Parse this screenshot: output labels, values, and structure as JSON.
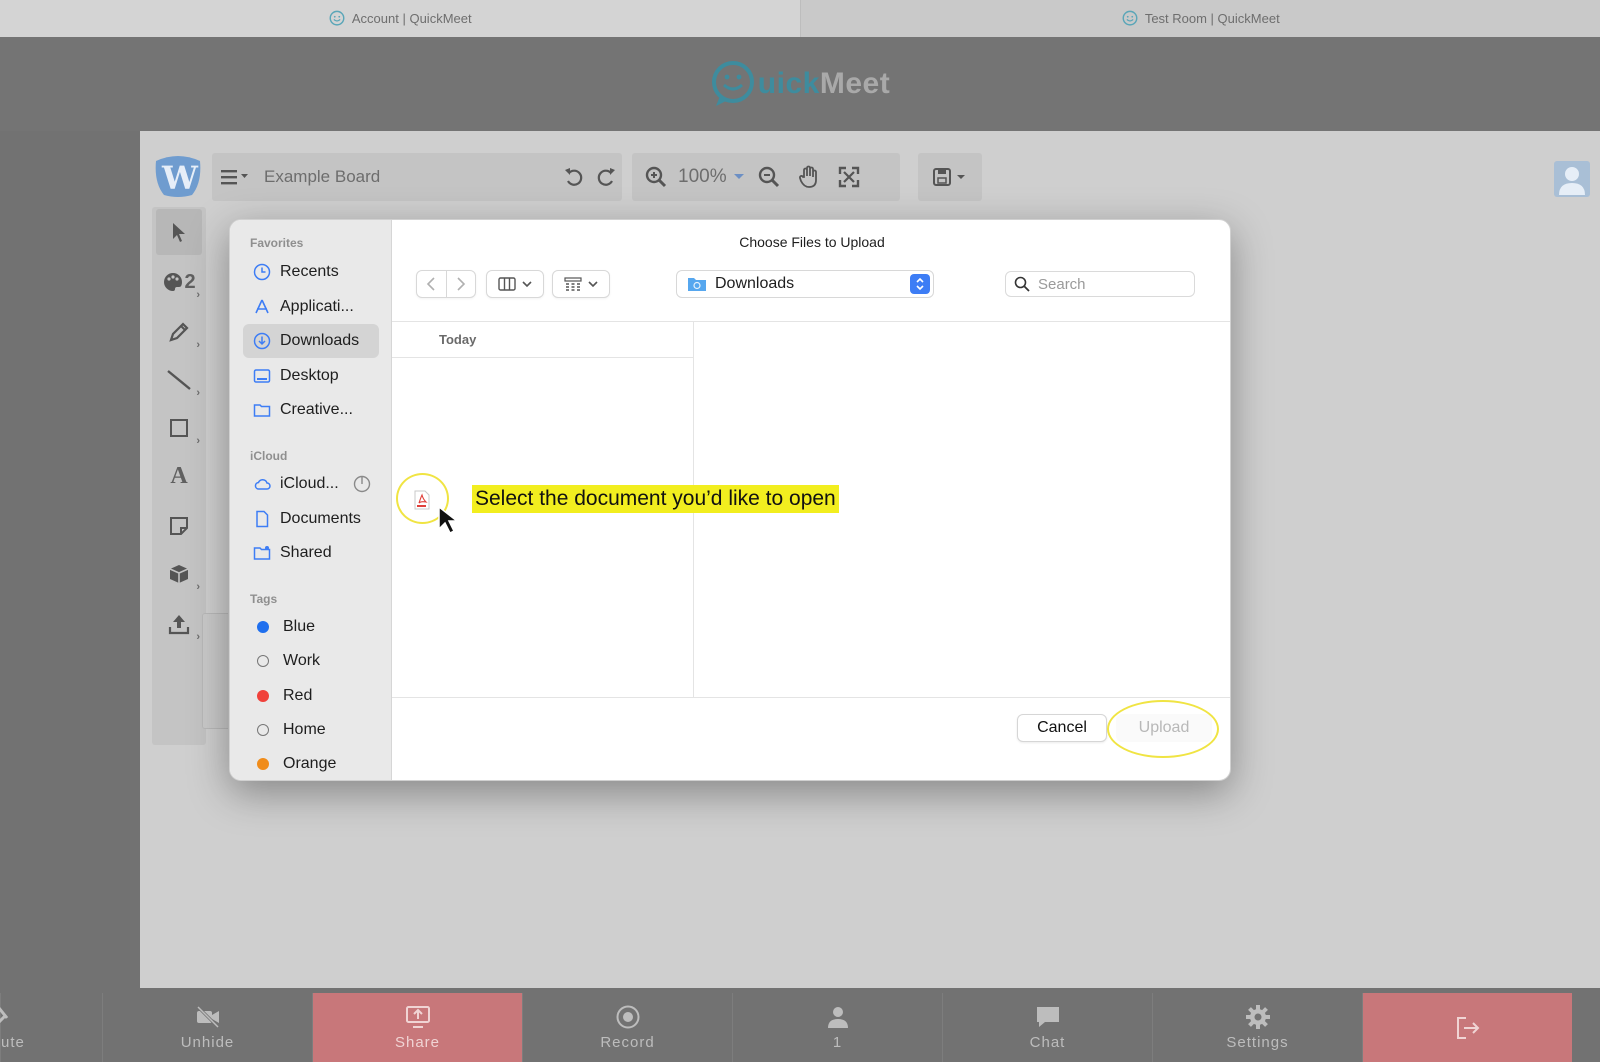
{
  "browser_tabs": [
    {
      "label": "Account | QuickMeet"
    },
    {
      "label": "Test Room | QuickMeet"
    }
  ],
  "header": {
    "logo_q": "Q",
    "logo_uick": "uick",
    "logo_meet": "Meet"
  },
  "board": {
    "title": "Example Board",
    "zoom": "100%"
  },
  "side_tools": [
    {
      "name": "select-tool"
    },
    {
      "name": "palette-tool",
      "badge": "2"
    },
    {
      "name": "pen-tool"
    },
    {
      "name": "line-tool"
    },
    {
      "name": "rectangle-tool"
    },
    {
      "name": "text-tool",
      "glyph": "A"
    },
    {
      "name": "sticky-note-tool"
    },
    {
      "name": "shape-3d-tool"
    },
    {
      "name": "upload-tool"
    }
  ],
  "dialog": {
    "title": "Choose Files to Upload",
    "sidebar": {
      "favorites_label": "Favorites",
      "favorites": [
        "Recents",
        "Applicati...",
        "Downloads",
        "Desktop",
        "Creative..."
      ],
      "icloud_label": "iCloud",
      "icloud": [
        "iCloud...",
        "Documents",
        "Shared"
      ],
      "tags_label": "Tags",
      "tags": [
        {
          "label": "Blue",
          "color": "#1f6fee"
        },
        {
          "label": "Work",
          "color": ""
        },
        {
          "label": "Red",
          "color": "#f0413b"
        },
        {
          "label": "Home",
          "color": ""
        },
        {
          "label": "Orange",
          "color": "#f08c1a"
        }
      ]
    },
    "location": "Downloads",
    "search_placeholder": "Search",
    "column_header": "Today",
    "callout": "Select the document you’d like to open",
    "cancel_label": "Cancel",
    "upload_label": "Upload"
  },
  "bottom_bar": [
    {
      "label": "ute"
    },
    {
      "label": "Unhide"
    },
    {
      "label": "Share"
    },
    {
      "label": "Record"
    },
    {
      "label": "1"
    },
    {
      "label": "Chat"
    },
    {
      "label": "Settings"
    },
    {
      "label": ""
    }
  ],
  "colors": {
    "accent_blue": "#3d7df5",
    "highlight_yellow": "#f2ee1f",
    "share_red": "#c8777a",
    "logo_teal": "#3e8c9e"
  }
}
